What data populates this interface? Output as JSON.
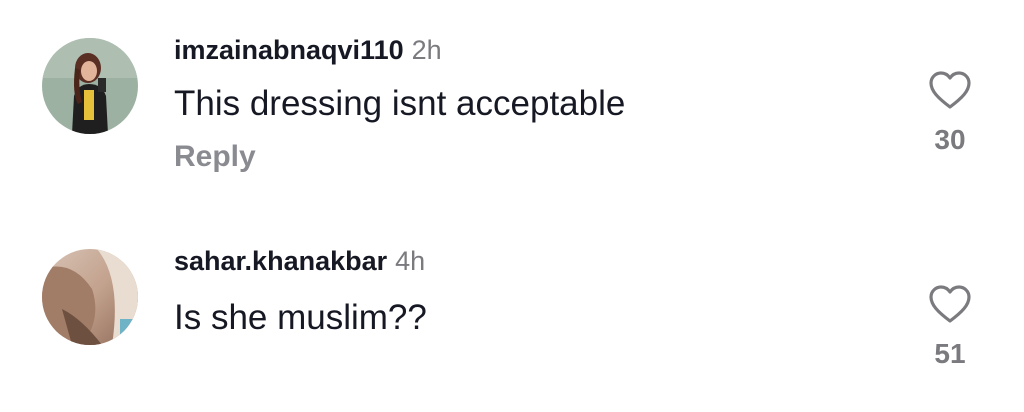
{
  "comments": [
    {
      "username": "imzainabnaqvi110",
      "time": "2h",
      "text": "This dressing isnt acceptable",
      "reply_label": "Reply",
      "likes": "30",
      "avatar_icon": "user-avatar-photo"
    },
    {
      "username": "sahar.khanakbar",
      "time": "4h",
      "text": "Is she muslim??",
      "likes": "51",
      "avatar_icon": "user-avatar-photo"
    }
  ],
  "colors": {
    "text": "#161823",
    "muted": "#7b7b7f",
    "reply": "#8a8b91",
    "background": "#ffffff"
  },
  "icons": {
    "like": "heart-outline-icon"
  }
}
